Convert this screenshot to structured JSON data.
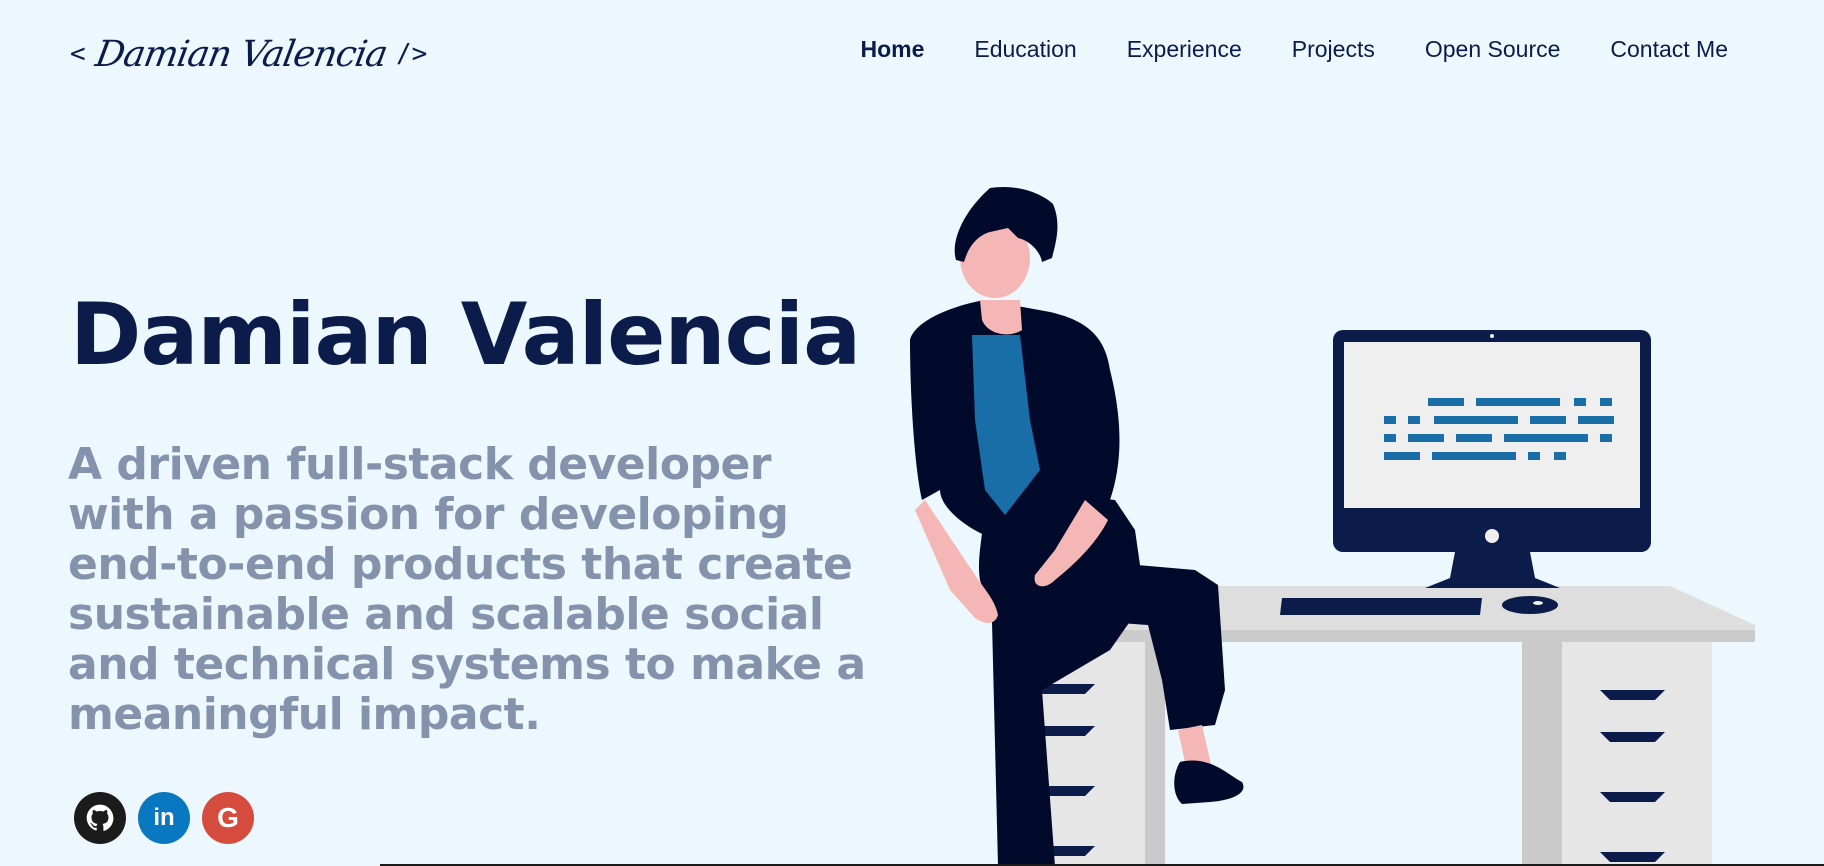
{
  "header": {
    "logo": {
      "open": "<",
      "signature": "Damian Valencia",
      "close": "/>"
    },
    "nav": [
      {
        "label": "Home",
        "active": true
      },
      {
        "label": "Education",
        "active": false
      },
      {
        "label": "Experience",
        "active": false
      },
      {
        "label": "Projects",
        "active": false
      },
      {
        "label": "Open Source",
        "active": false
      },
      {
        "label": "Contact Me",
        "active": false
      }
    ]
  },
  "hero": {
    "title": "Damian Valencia",
    "subtitle": "A driven full-stack developer with a passion for developing end-to-end products that create sustainable and scalable social and technical systems to make a meaningful impact."
  },
  "social": [
    {
      "name": "github-icon",
      "text": "",
      "color": "#1b1b1b"
    },
    {
      "name": "linkedin-icon",
      "text": "in",
      "color": "#0a77c1"
    },
    {
      "name": "google-icon",
      "text": "G",
      "color": "#d54b3d"
    }
  ],
  "colors": {
    "background": "#ecf8fe",
    "primary": "#0b1c4a",
    "subtitle": "#8592ab",
    "accent_blue": "#1a6ea8"
  }
}
